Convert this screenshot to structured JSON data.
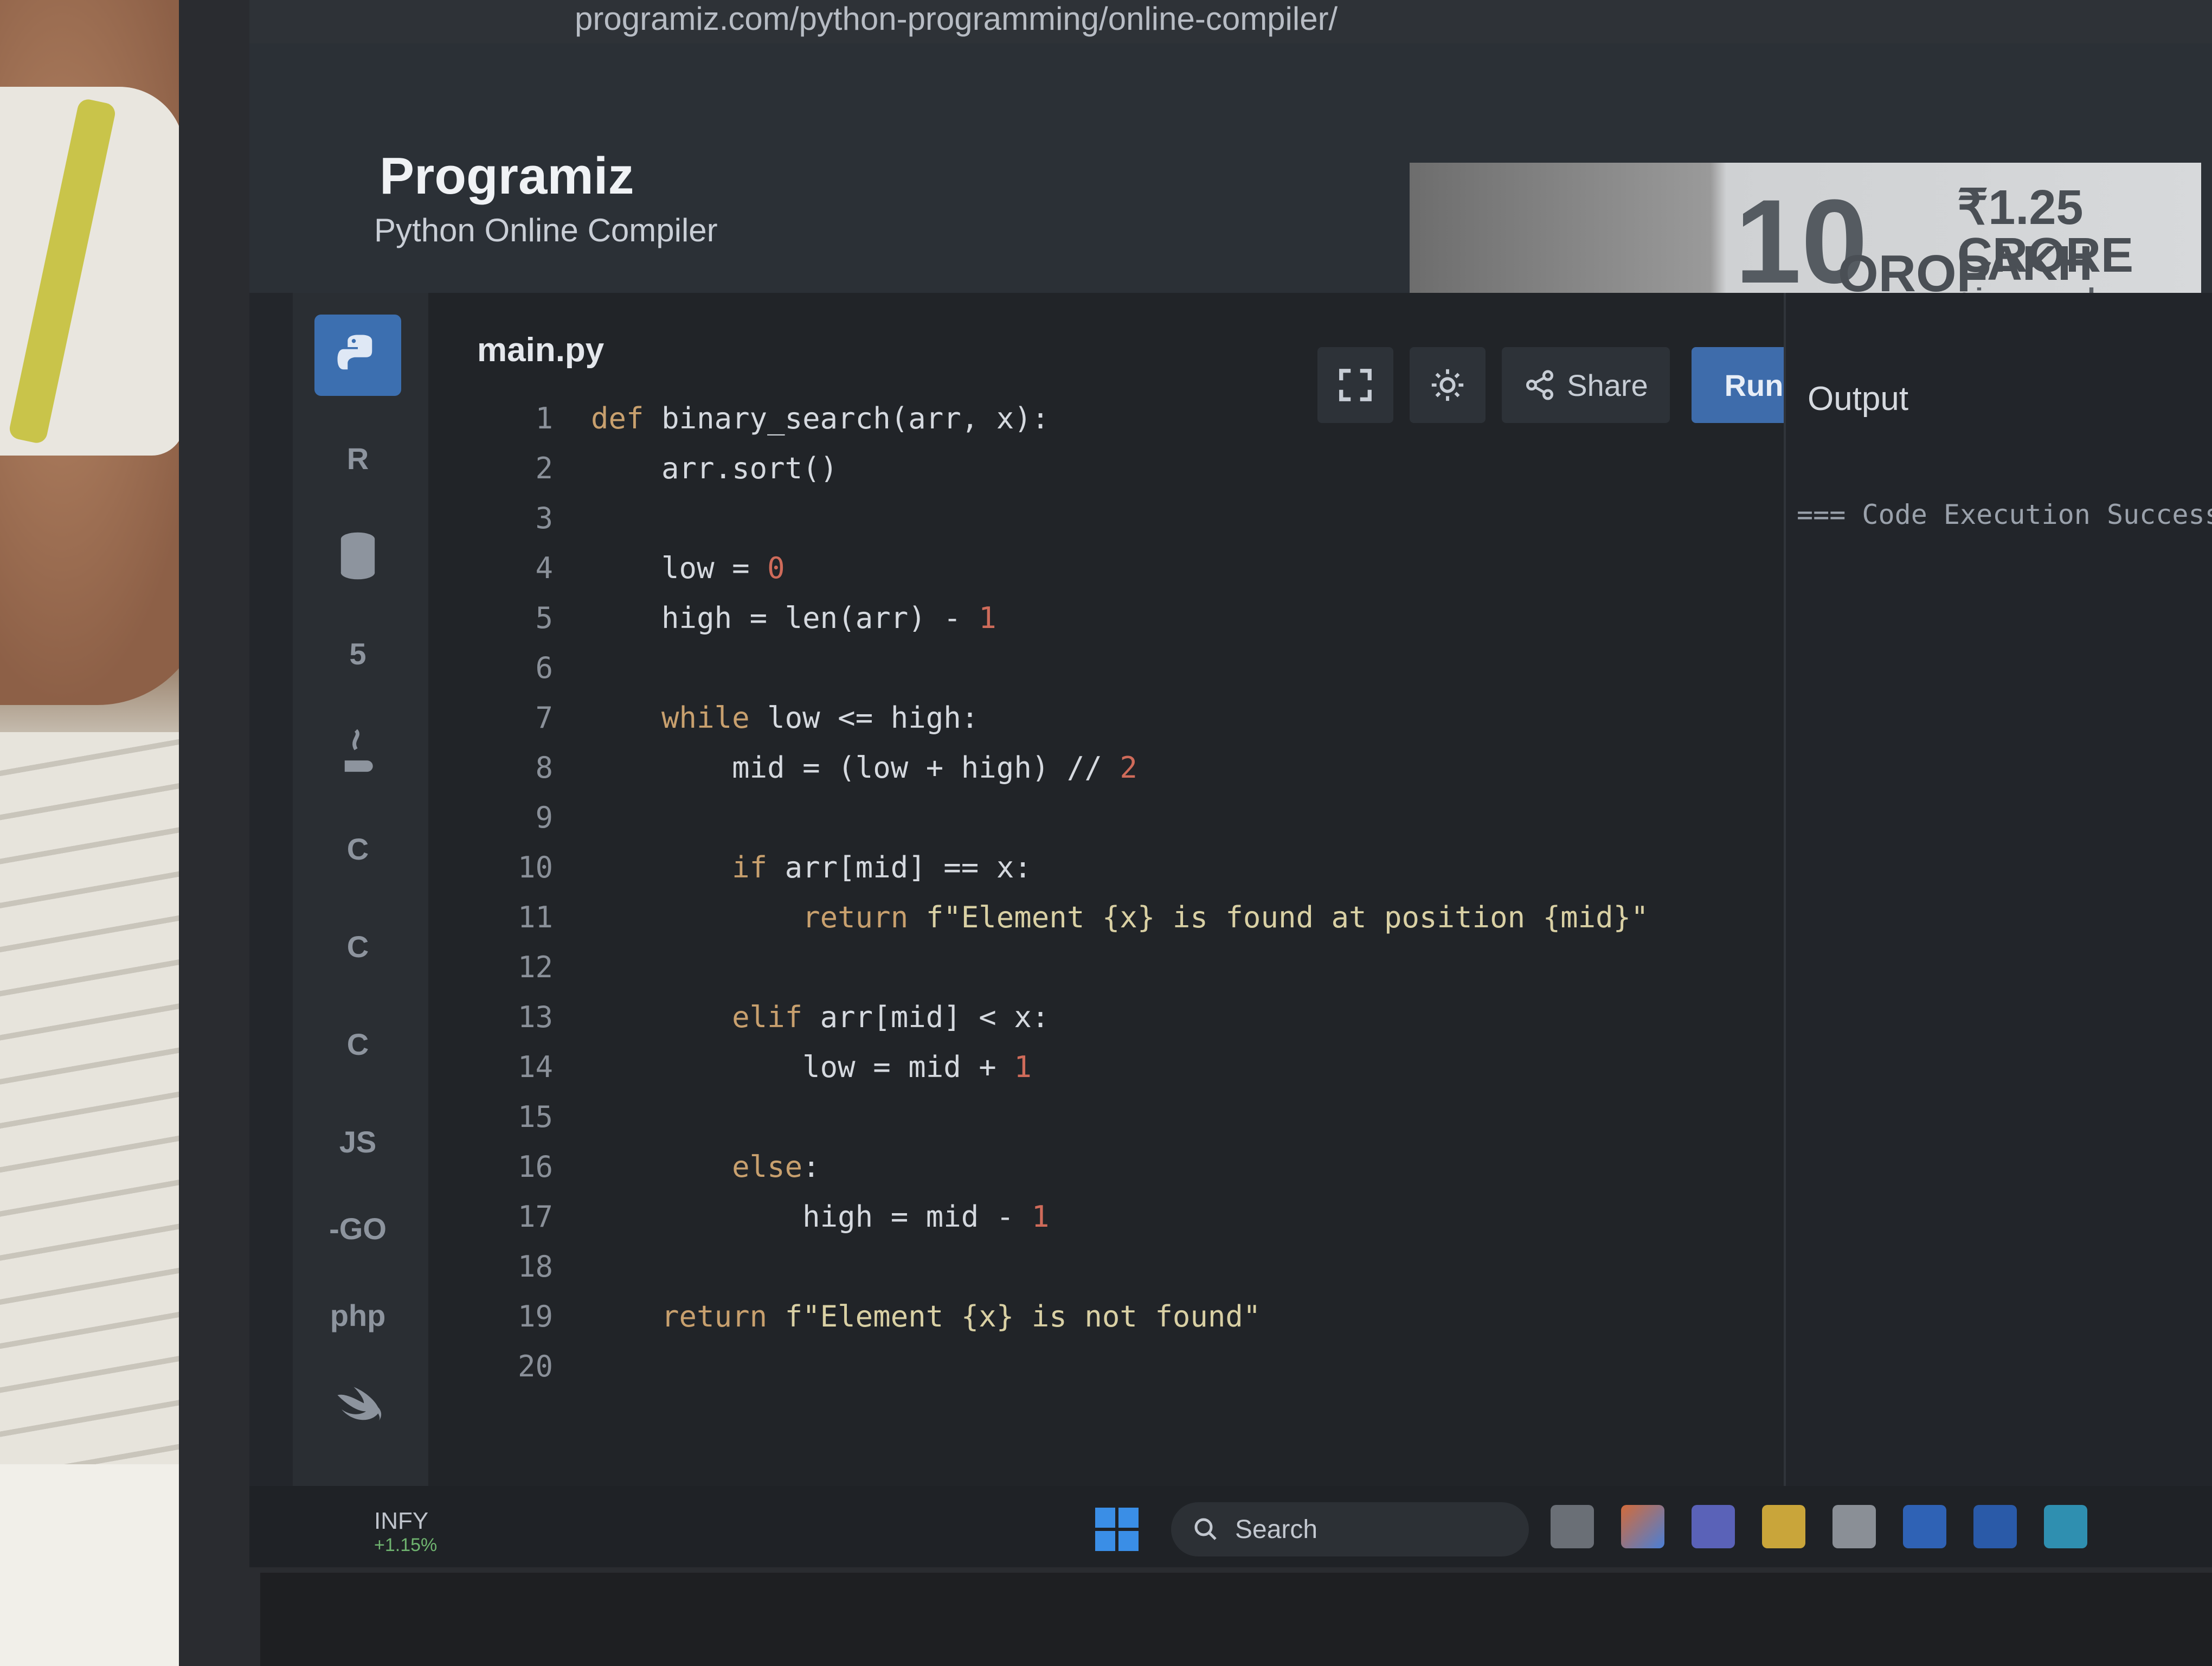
{
  "browser": {
    "url": "programiz.com/python-programming/online-compiler/"
  },
  "header": {
    "logo": "Programiz",
    "subtitle": "Python Online Compiler"
  },
  "ad": {
    "big_text": "10",
    "orop": "OROP",
    "amount": "₹1.25 LAKH",
    "crore": "CRORE",
    "given": "given under OROP"
  },
  "sidebar": {
    "items": [
      {
        "icon": "python-icon",
        "label": ""
      },
      {
        "icon": "r-icon",
        "label": "R"
      },
      {
        "icon": "database-icon",
        "label": ""
      },
      {
        "icon": "html5-icon",
        "label": "5"
      },
      {
        "icon": "java-icon",
        "label": ""
      },
      {
        "icon": "c-icon",
        "label": "C"
      },
      {
        "icon": "cpp-icon",
        "label": "C"
      },
      {
        "icon": "csharp-icon",
        "label": "C"
      },
      {
        "icon": "js-icon",
        "label": "JS"
      },
      {
        "icon": "go-icon",
        "label": "-GO"
      },
      {
        "icon": "php-icon",
        "label": "php"
      },
      {
        "icon": "swift-icon",
        "label": ""
      }
    ]
  },
  "editor": {
    "filename": "main.py",
    "share_label": "Share",
    "run_label": "Run",
    "line_numbers": [
      "1",
      "2",
      "3",
      "4",
      "5",
      "6",
      "7",
      "8",
      "9",
      "10",
      "11",
      "12",
      "13",
      "14",
      "15",
      "16",
      "17",
      "18",
      "19",
      "20"
    ],
    "code": [
      "def binary_search(arr, x):",
      "    arr.sort()",
      "",
      "    low = 0",
      "    high = len(arr) - 1",
      "",
      "    while low <= high:",
      "        mid = (low + high) // 2",
      "",
      "        if arr[mid] == x:",
      "            return f\"Element {x} is found at position {mid}\"",
      "",
      "        elif arr[mid] < x:",
      "            low = mid + 1",
      "",
      "        else:",
      "            high = mid - 1",
      "",
      "    return f\"Element {x} is not found\"",
      ""
    ]
  },
  "output": {
    "title": "Output",
    "text": "=== Code Execution Successful ==="
  },
  "taskbar": {
    "stock_name": "INFY",
    "stock_change": "+1.15%",
    "search_placeholder": "Search"
  },
  "colors": {
    "accent": "#3e6cab",
    "background": "#212428"
  }
}
